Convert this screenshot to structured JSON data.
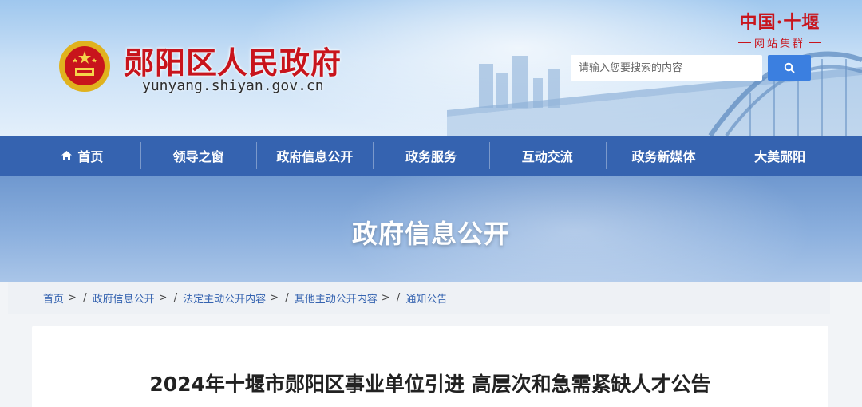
{
  "header": {
    "site_title": "郧阳区人民政府",
    "site_url": "yunyang.shiyan.gov.cn",
    "network_badge": {
      "main": "中国·十堰",
      "sub": "网站集群"
    },
    "search": {
      "placeholder": "请输入您要搜索的内容"
    }
  },
  "nav": {
    "items": [
      {
        "label": "首页",
        "icon": "home-icon"
      },
      {
        "label": "领导之窗"
      },
      {
        "label": "政府信息公开"
      },
      {
        "label": "政务服务"
      },
      {
        "label": "互动交流"
      },
      {
        "label": "政务新媒体"
      },
      {
        "label": "大美郧阳"
      }
    ]
  },
  "banner": {
    "title": "政府信息公开"
  },
  "breadcrumb": {
    "items": [
      "首页",
      "政府信息公开",
      "法定主动公开内容",
      "其他主动公开内容",
      "通知公告"
    ],
    "separator": ">",
    "slash": "/"
  },
  "article": {
    "title": "2024年十堰市郧阳区事业单位引进 高层次和急需紧缺人才公告"
  },
  "colors": {
    "brand_red": "#c8141c",
    "nav_blue": "#3563b0",
    "search_button": "#3b7fe0",
    "link_blue": "#3563b0"
  }
}
